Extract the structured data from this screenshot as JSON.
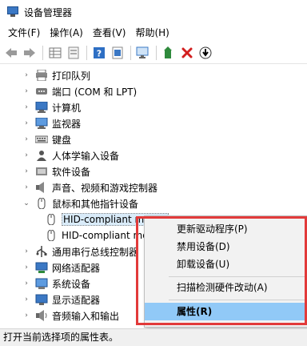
{
  "window": {
    "title": "设备管理器"
  },
  "menu": [
    "文件(F)",
    "操作(A)",
    "查看(V)",
    "帮助(H)"
  ],
  "toolbar": {
    "icons": [
      "back-arrow-icon",
      "forward-arrow-icon",
      "properties-grid-icon",
      "properties-page-icon",
      "help-icon",
      "show-hidden-icon",
      "scan-hardware-icon",
      "update-driver-icon",
      "uninstall-icon",
      "install-icon"
    ]
  },
  "tree": [
    {
      "label": "打印队列",
      "icon": "printer-icon",
      "expanded": false
    },
    {
      "label": "端口 (COM 和 LPT)",
      "icon": "port-icon",
      "expanded": false
    },
    {
      "label": "计算机",
      "icon": "computer-icon",
      "expanded": false
    },
    {
      "label": "监视器",
      "icon": "monitor-icon",
      "expanded": false
    },
    {
      "label": "键盘",
      "icon": "keyboard-icon",
      "expanded": false
    },
    {
      "label": "人体学输入设备",
      "icon": "hid-icon",
      "expanded": false
    },
    {
      "label": "软件设备",
      "icon": "software-device-icon",
      "expanded": false
    },
    {
      "label": "声音、视频和游戏控制器",
      "icon": "speaker-icon",
      "expanded": false
    },
    {
      "label": "鼠标和其他指针设备",
      "icon": "mouse-icon",
      "expanded": true
    },
    {
      "label": "HID-compliant mouse",
      "icon": "mouse-icon",
      "child": true,
      "selected": true
    },
    {
      "label": "HID-compliant mouse",
      "icon": "mouse-icon",
      "child": true
    },
    {
      "label": "通用串行总线控制器",
      "icon": "usb-icon",
      "expanded": false
    },
    {
      "label": "网络适配器",
      "icon": "network-icon",
      "expanded": false
    },
    {
      "label": "系统设备",
      "icon": "system-device-icon",
      "expanded": false
    },
    {
      "label": "显示适配器",
      "icon": "display-adapter-icon",
      "expanded": false
    },
    {
      "label": "音频输入和输出",
      "icon": "audio-icon",
      "expanded": false
    }
  ],
  "context_menu": {
    "items": [
      "更新驱动程序(P)",
      "禁用设备(D)",
      "卸载设备(U)",
      "扫描检测硬件改动(A)",
      "属性(R)"
    ],
    "active": "属性(R)"
  },
  "statusbar": {
    "text": "打开当前选择项的属性表。"
  },
  "colors": {
    "annotation_frame": "#e23a3a",
    "menu_highlight": "#91c9f7",
    "selection": "#d9ebf9"
  }
}
